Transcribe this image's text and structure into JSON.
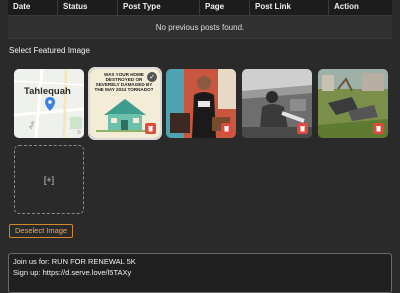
{
  "table": {
    "columns": [
      "Date",
      "Status",
      "Post Type",
      "Page",
      "Post Link",
      "Action"
    ],
    "empty_message": "No previous posts found."
  },
  "featured": {
    "title": "Select Featured Image",
    "images": [
      {
        "name": "map-thumbnail",
        "map_label": "Tahlequah",
        "street": "Ave",
        "corner": "©",
        "selected": false
      },
      {
        "name": "tornado-flyer-thumbnail",
        "flyer_text": "WAS YOUR HOME DESTROYED OR SEVERELY DAMAGED BY THE MAY 2024 TORNADO?",
        "selected": true
      },
      {
        "name": "volunteer-photo-thumbnail",
        "selected": false
      },
      {
        "name": "worker-photo-thumbnail",
        "selected": false
      },
      {
        "name": "debris-photo-thumbnail",
        "selected": false
      }
    ],
    "upload_label": "[+]",
    "deselect_label": "Deselect Image"
  },
  "post_text": {
    "line1": "Join us for: RUN FOR RENEWAL 5K",
    "line2": "Sign up: https://d.serve.love/l5TAXy"
  },
  "colors": {
    "accent": "#d4862d",
    "delete": "#e04a3a"
  },
  "icons": {
    "delete": "trash-icon",
    "selected": "checkmark-icon",
    "map_pin": "map-pin-icon"
  }
}
